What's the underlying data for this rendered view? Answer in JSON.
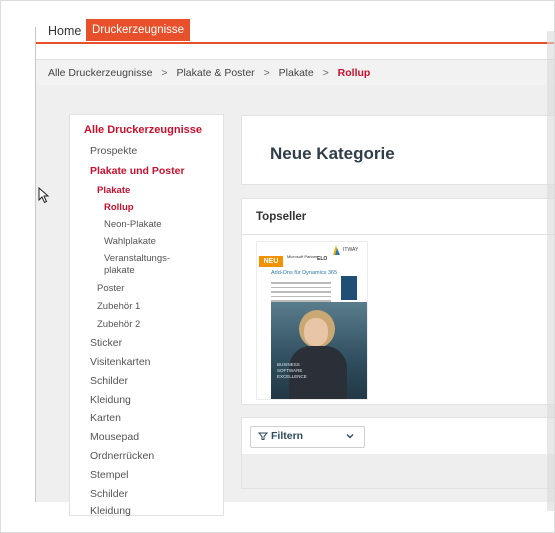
{
  "nav": {
    "home": "Home",
    "active_tab": "Druckerzeugnisse"
  },
  "breadcrumb": {
    "items": [
      "Alle Druckerzeugnisse",
      "Plakate & Poster",
      "Plakate",
      "Rollup"
    ],
    "separator": ">"
  },
  "sidebar": {
    "items": [
      {
        "label": "Alle Druckerzeugnisse"
      },
      {
        "label": "Prospekte"
      },
      {
        "label": "Plakate und Poster"
      },
      {
        "label": "Plakate"
      },
      {
        "label": "Rollup"
      },
      {
        "label": "Neon-Plakate"
      },
      {
        "label": "Wahlplakate"
      },
      {
        "label": "Veranstaltungs-\nplakate"
      },
      {
        "label": "Poster"
      },
      {
        "label": "Zubehör 1"
      },
      {
        "label": "Zubehör 2"
      },
      {
        "label": "Sticker"
      },
      {
        "label": "Visitenkarten"
      },
      {
        "label": "Schilder"
      },
      {
        "label": "Kleidung"
      },
      {
        "label": "Karten"
      },
      {
        "label": "Mousepad"
      },
      {
        "label": "Ordnerrücken"
      },
      {
        "label": "Stempel"
      },
      {
        "label": "Schilder"
      },
      {
        "label": "Kleidung"
      }
    ]
  },
  "category": {
    "title": "Neue Kategorie"
  },
  "topseller": {
    "title": "Topseller",
    "product": {
      "badge": "NEU",
      "brand": "ITWAY",
      "partner": "Microsoft Partner",
      "elo": "ELO",
      "addon": "Add-Ons für Dynamics 365",
      "tagline": "BUSINESS SOFTWARE EXCELLENCE"
    }
  },
  "filter": {
    "label": "Filtern"
  },
  "colors": {
    "accent": "#e8502b",
    "active_red": "#c8102e",
    "title_dark": "#2f3e4a"
  }
}
